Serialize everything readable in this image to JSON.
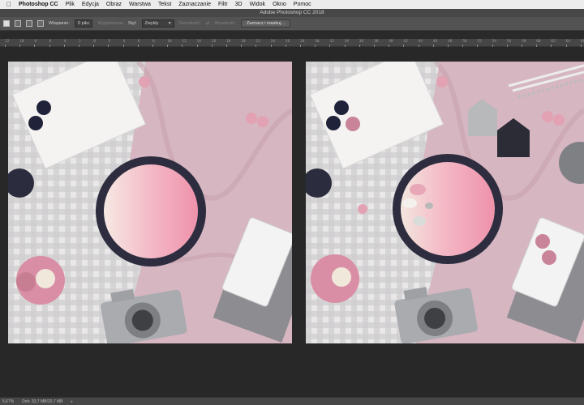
{
  "menubar": {
    "app_name": "Photoshop CC",
    "items": [
      "Plik",
      "Edycja",
      "Obraz",
      "Warstwa",
      "Tekst",
      "Zaznaczanie",
      "Filtr",
      "3D",
      "Widok",
      "Okno",
      "Pomoc"
    ]
  },
  "window": {
    "title": "Adobe Photoshop CC 2018"
  },
  "options": {
    "feather_label": "Wtapianie:",
    "feather_value": "0 pikс",
    "antialias_label": "Wygładzanie",
    "style_label": "Styl:",
    "style_value": "Zwykły",
    "width_label": "Szerokość:",
    "height_label": "Wysokość:",
    "select_mask_button": "Zaznacz i maskuj..."
  },
  "ruler": {
    "ticks": [
      "12",
      "10",
      "8",
      "6",
      "4",
      "2",
      "0",
      "2",
      "4",
      "6",
      "8",
      "10",
      "12",
      "14",
      "16",
      "18",
      "20",
      "22",
      "24",
      "26",
      "28",
      "30",
      "32",
      "34",
      "36",
      "38",
      "40",
      "42",
      "44",
      "46",
      "48",
      "50",
      "52",
      "54",
      "56",
      "58",
      "60",
      "62",
      "64",
      "66"
    ]
  },
  "statusbar": {
    "zoom": "5,67%",
    "doc_info": "Dok: 33,7 MB/20,7 MB"
  },
  "colors": {
    "menubar_bg": "#ececec",
    "panel_bg": "#535353",
    "workspace_bg": "#282828",
    "fabric_pink": "#d8b9c3",
    "tray_navy": "#2d2d3f",
    "pink_fill": "#f2a4b8"
  }
}
